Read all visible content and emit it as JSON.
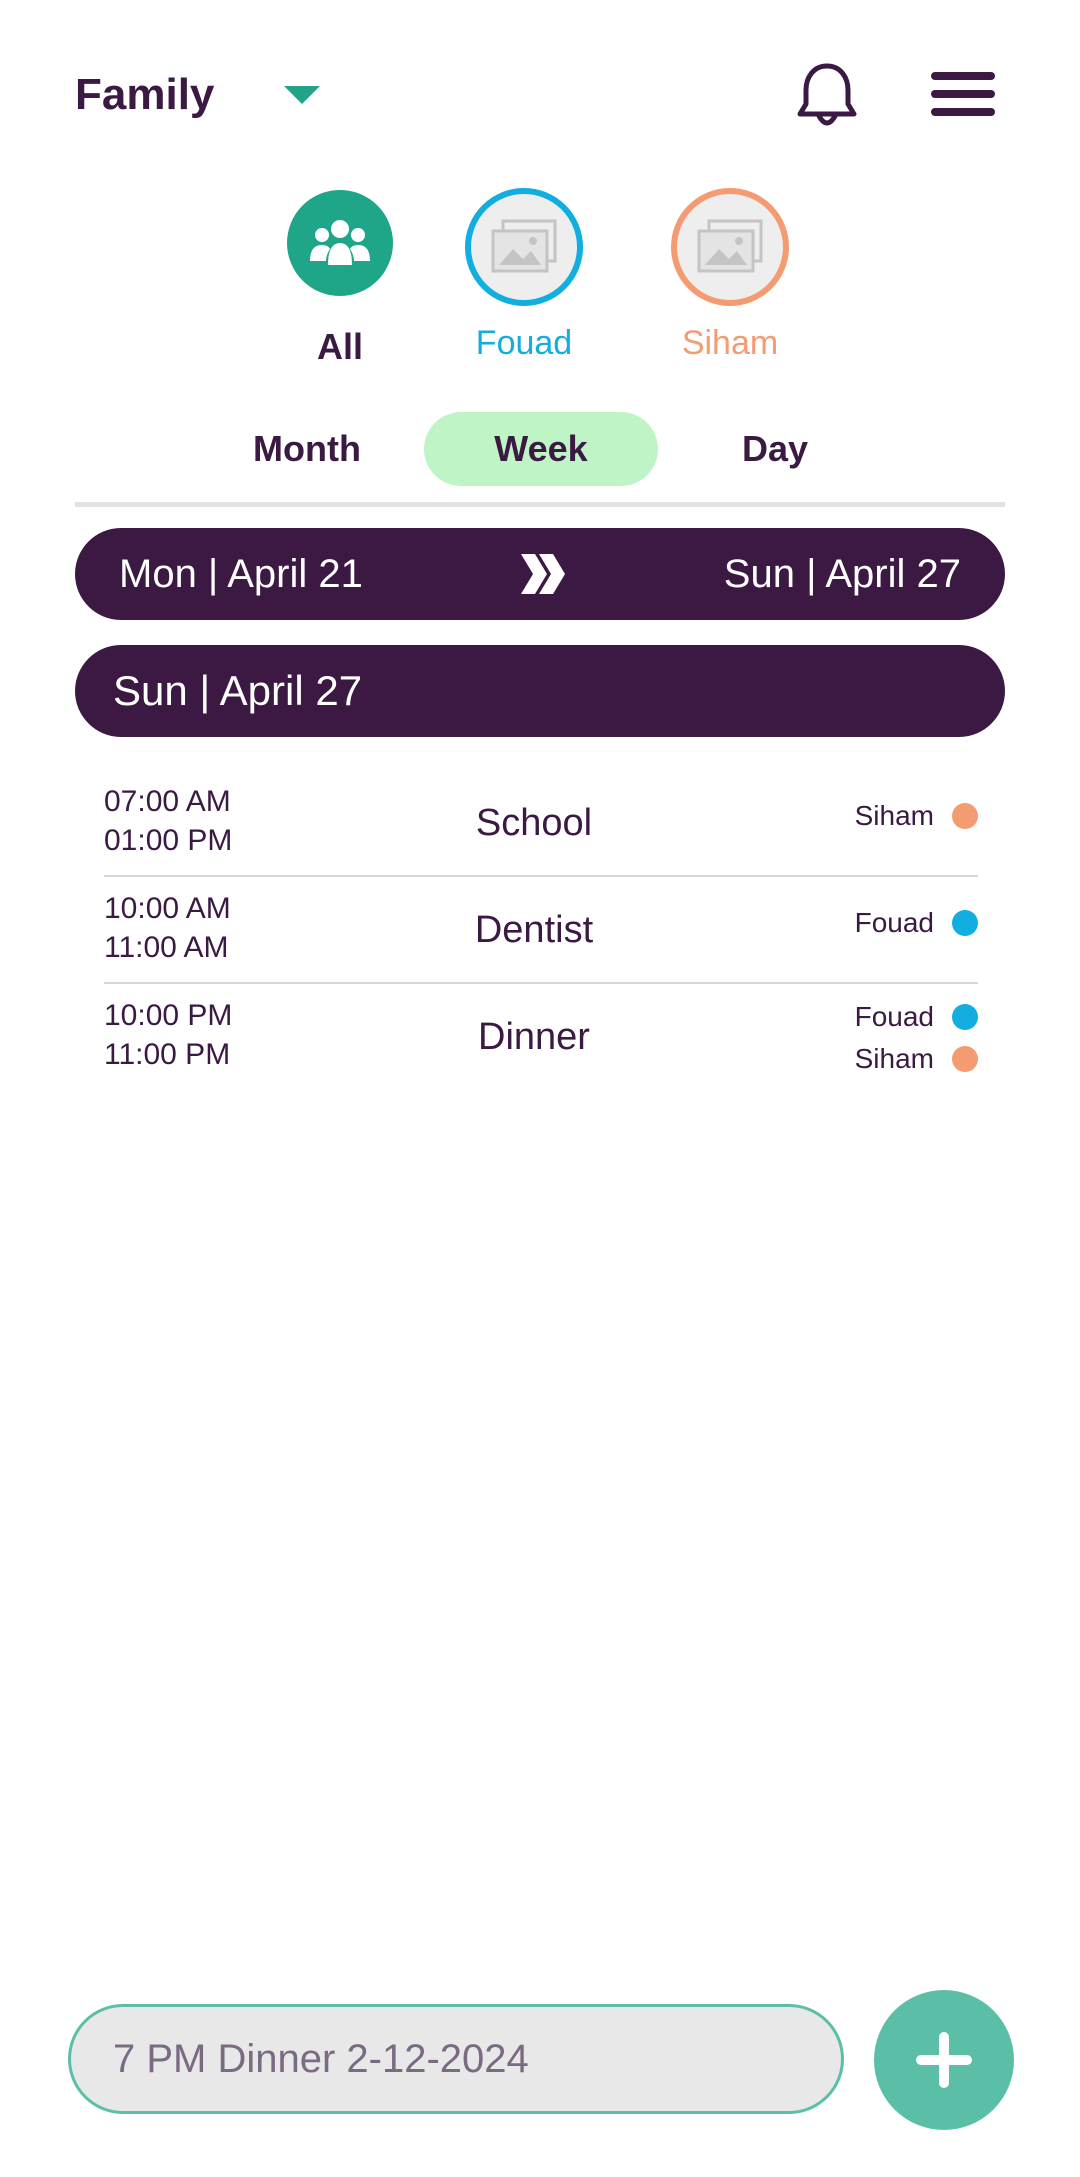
{
  "header": {
    "family_label": "Family"
  },
  "members": [
    {
      "name": "All",
      "color": "#1fa587"
    },
    {
      "name": "Fouad",
      "color": "#12aee0"
    },
    {
      "name": "Siham",
      "color": "#f59b72"
    }
  ],
  "tabs": {
    "month": "Month",
    "week": "Week",
    "day": "Day",
    "active": "Week"
  },
  "range": {
    "start": "Mon | April 21",
    "end": "Sun | April 27"
  },
  "day": {
    "label": "Sun  | April 27"
  },
  "events": [
    {
      "start": "07:00 AM",
      "end": "01:00 PM",
      "title": "School",
      "people": [
        {
          "name": "Siham",
          "color": "#f59b72"
        }
      ]
    },
    {
      "start": "10:00 AM",
      "end": "11:00 AM",
      "title": "Dentist",
      "people": [
        {
          "name": "Fouad",
          "color": "#12aee0"
        }
      ]
    },
    {
      "start": "10:00 PM",
      "end": "11:00 PM",
      "title": "Dinner",
      "people": [
        {
          "name": "Fouad",
          "color": "#12aee0"
        },
        {
          "name": "Siham",
          "color": "#f59b72"
        }
      ]
    }
  ],
  "quick_add": {
    "placeholder": "7 PM Dinner 2-12-2024"
  },
  "colors": {
    "primary_dark": "#3b1942",
    "accent_green": "#1fa587",
    "active_tab": "#bff4c6",
    "fab": "#5bbfa7"
  }
}
